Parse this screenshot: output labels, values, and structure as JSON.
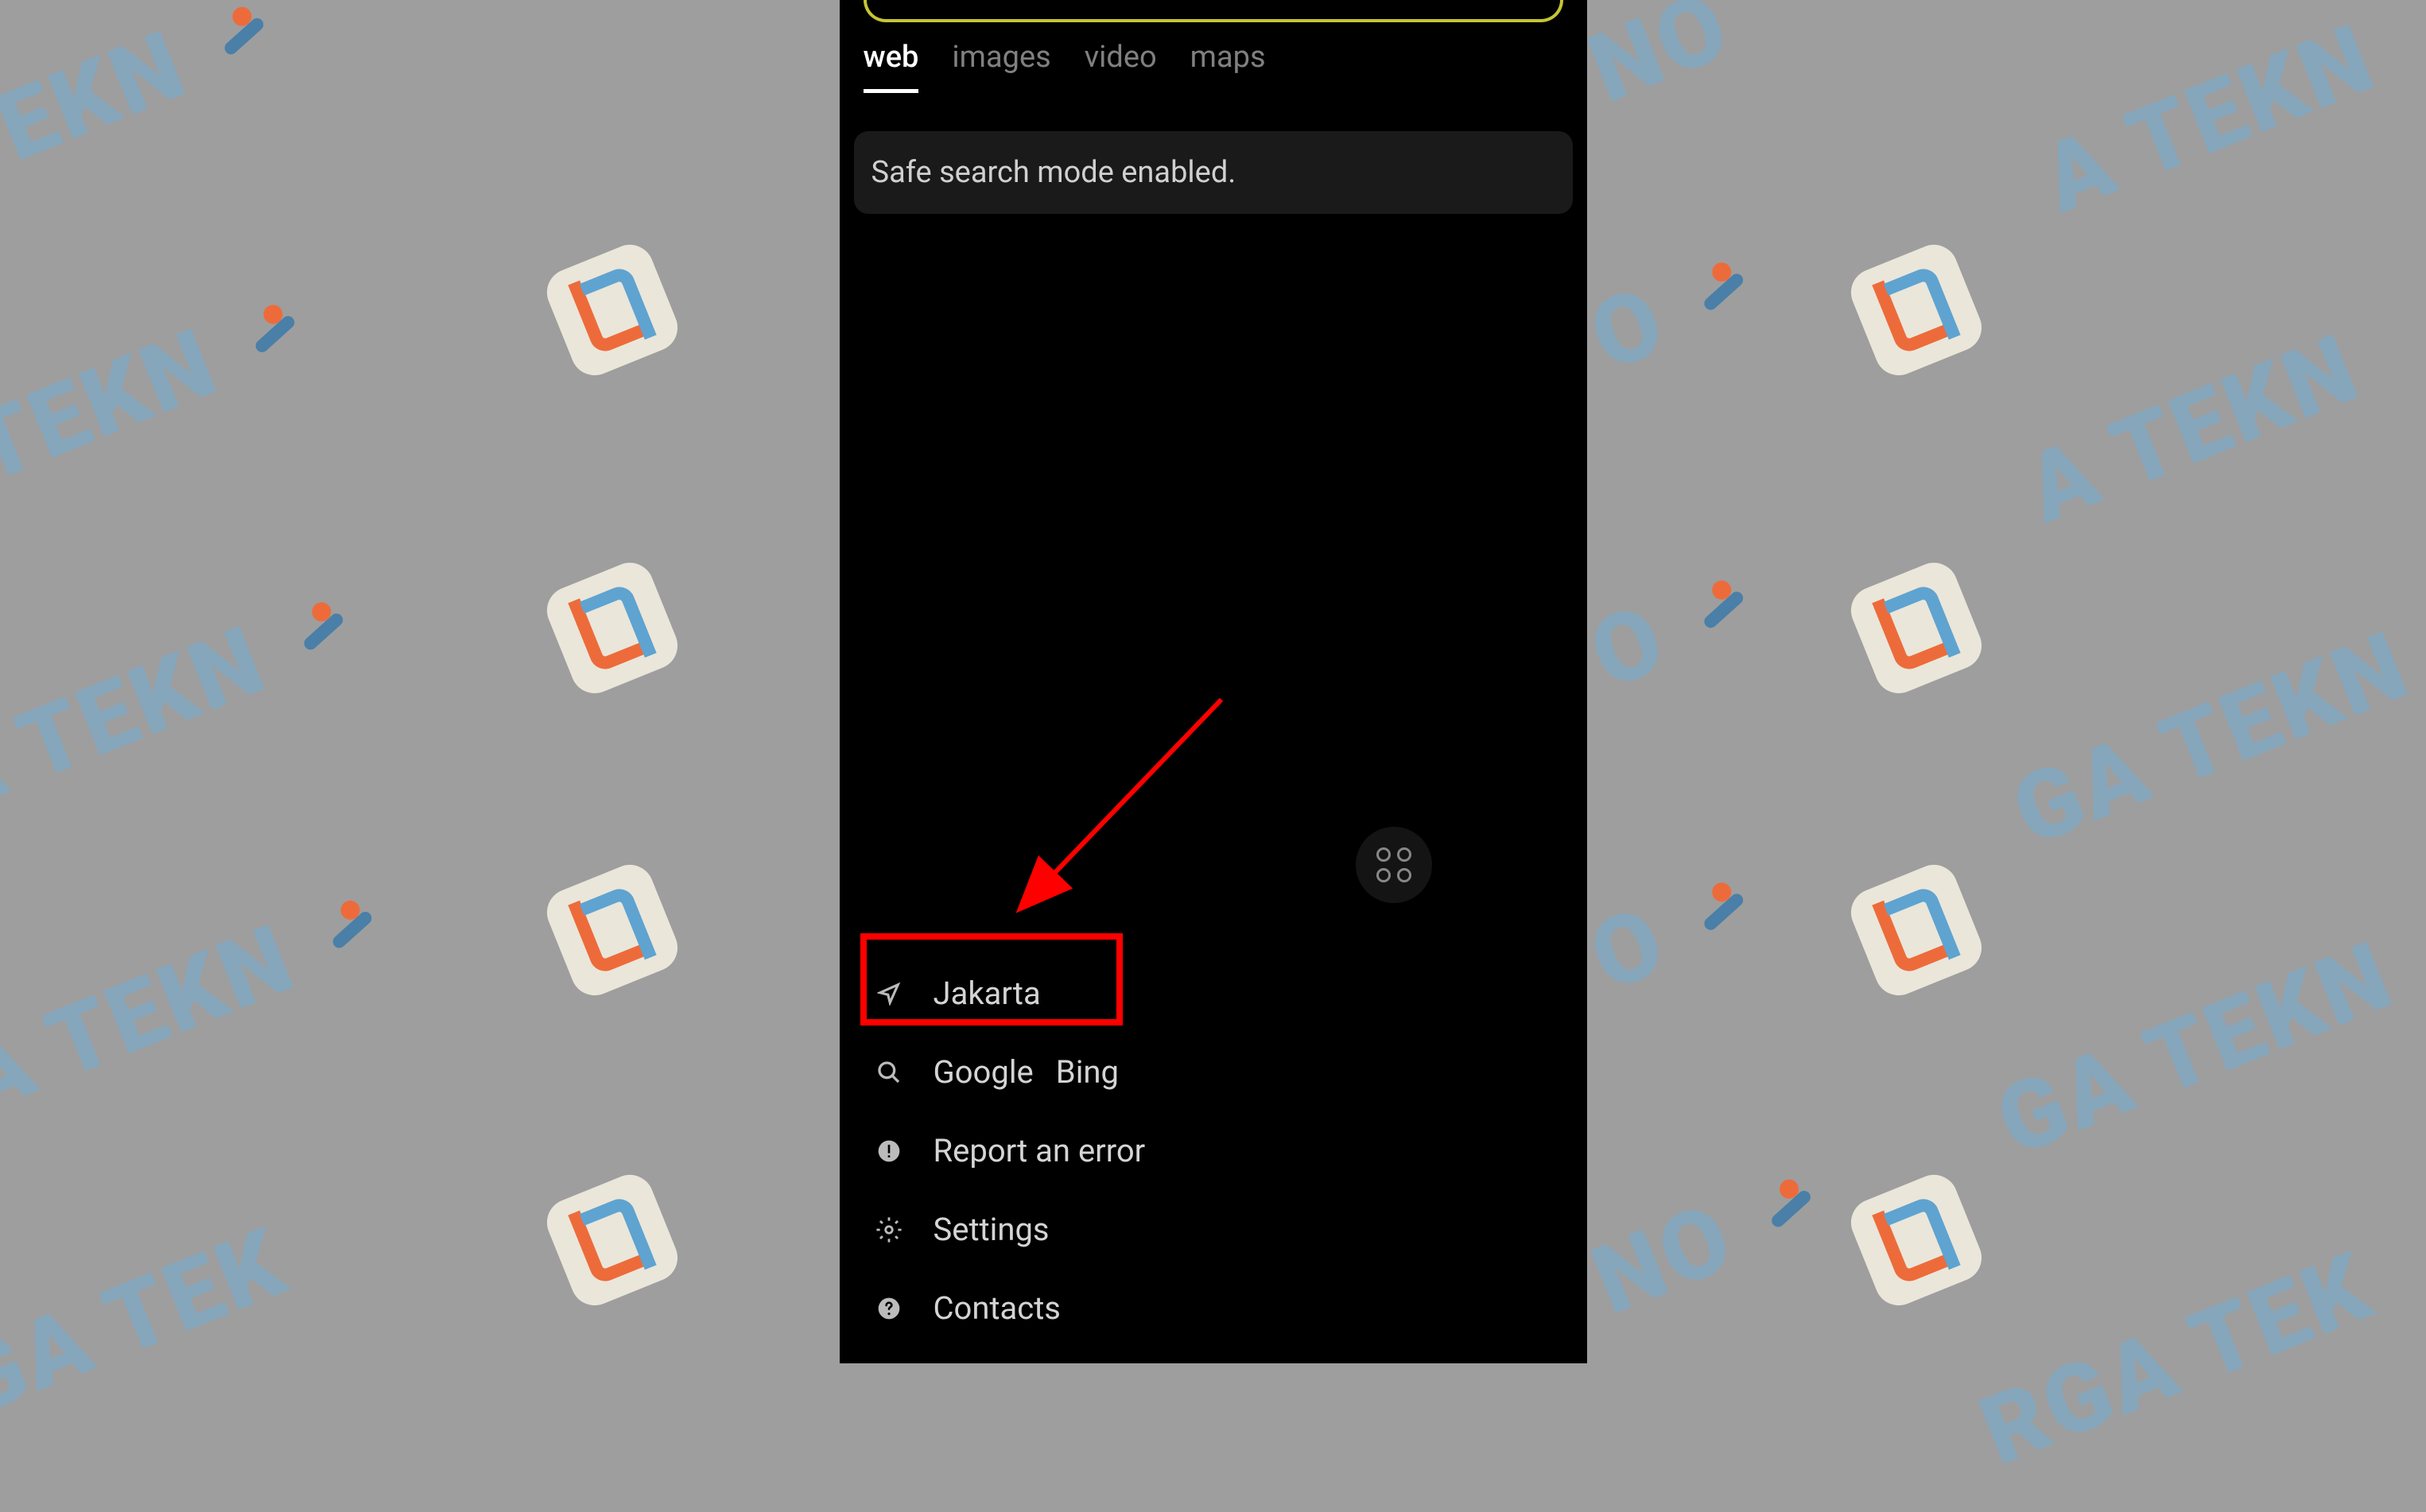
{
  "tabs": {
    "web": "web",
    "images": "images",
    "video": "video",
    "maps": "maps"
  },
  "safe_search_message": "Safe search mode enabled.",
  "menu": {
    "location": "Jakarta",
    "search_engines": {
      "google": "Google",
      "bing": "Bing"
    },
    "report_error": "Report an error",
    "settings": "Settings",
    "contacts": "Contacts"
  },
  "watermark_text": "SURGA TEKNO",
  "colors": {
    "highlight": "#ff0000",
    "search_outline": "#c5c534",
    "background": "#9e9e9e",
    "phone_bg": "#000000"
  }
}
